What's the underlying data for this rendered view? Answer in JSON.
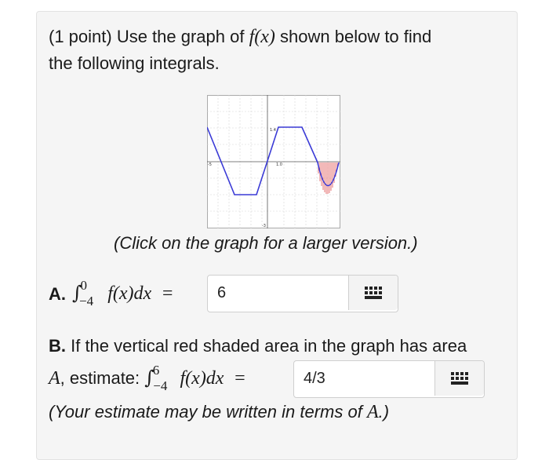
{
  "problem": {
    "intro_prefix": "(1 point) Use the graph of ",
    "intro_func": "f(x)",
    "intro_suffix_line1": " shown below to find",
    "intro_line2": "the following integrals.",
    "graph_caption": "(Click on the graph for a larger version.)",
    "graph_labels": {
      "y_top": "1.4",
      "origin": "1.0",
      "x_left": "-5",
      "x_bottom": "-3"
    },
    "part_a": {
      "label": "A.",
      "lower": "−4",
      "upper": "0",
      "integrand": "f(x)dx",
      "equals": "=",
      "answer": "6"
    },
    "part_b": {
      "label": "B.",
      "line1": " If the vertical red shaded area in the graph has area",
      "var_A": "A",
      "estimate": ", estimate: ",
      "lower": "−4",
      "upper": "6",
      "integrand": "f(x)dx",
      "equals": "=",
      "answer": "4/3",
      "note_prefix": "(Your estimate may be written in terms of ",
      "note_var": "A",
      "note_suffix": ".)"
    }
  },
  "colors": {
    "curve": "#3a3ad6",
    "shade": "#e05050",
    "grid": "#c8c8c8"
  },
  "icons": {
    "keyboard": "keyboard-icon"
  }
}
